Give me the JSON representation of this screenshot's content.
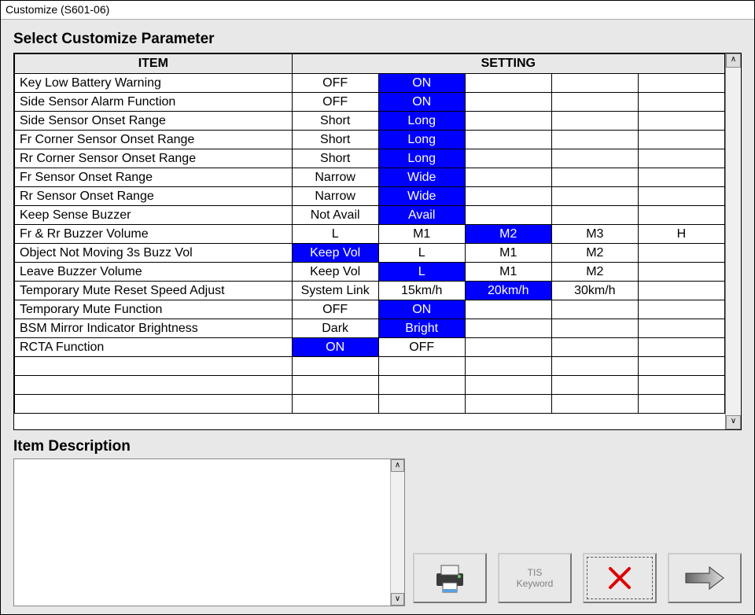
{
  "window": {
    "title": "Customize (S601-06)"
  },
  "headings": {
    "select_param": "Select Customize Parameter",
    "item_desc": "Item Description"
  },
  "table": {
    "headers": {
      "item": "ITEM",
      "setting": "SETTING"
    },
    "rows": [
      {
        "item": "Key Low Battery Warning",
        "opts": [
          "OFF",
          "ON",
          "",
          "",
          ""
        ],
        "sel": 1
      },
      {
        "item": "Side Sensor Alarm Function",
        "opts": [
          "OFF",
          "ON",
          "",
          "",
          ""
        ],
        "sel": 1
      },
      {
        "item": "Side Sensor Onset Range",
        "opts": [
          "Short",
          "Long",
          "",
          "",
          ""
        ],
        "sel": 1
      },
      {
        "item": "Fr Corner Sensor Onset Range",
        "opts": [
          "Short",
          "Long",
          "",
          "",
          ""
        ],
        "sel": 1
      },
      {
        "item": "Rr Corner Sensor Onset Range",
        "opts": [
          "Short",
          "Long",
          "",
          "",
          ""
        ],
        "sel": 1
      },
      {
        "item": "Fr Sensor Onset Range",
        "opts": [
          "Narrow",
          "Wide",
          "",
          "",
          ""
        ],
        "sel": 1
      },
      {
        "item": "Rr Sensor Onset Range",
        "opts": [
          "Narrow",
          "Wide",
          "",
          "",
          ""
        ],
        "sel": 1
      },
      {
        "item": "Keep Sense Buzzer",
        "opts": [
          "Not Avail",
          "Avail",
          "",
          "",
          ""
        ],
        "sel": 1
      },
      {
        "item": "Fr & Rr Buzzer Volume",
        "opts": [
          "L",
          "M1",
          "M2",
          "M3",
          "H"
        ],
        "sel": 2
      },
      {
        "item": "Object Not Moving 3s Buzz Vol",
        "opts": [
          "Keep Vol",
          "L",
          "M1",
          "M2",
          ""
        ],
        "sel": 0
      },
      {
        "item": "Leave Buzzer Volume",
        "opts": [
          "Keep Vol",
          "L",
          "M1",
          "M2",
          ""
        ],
        "sel": 1
      },
      {
        "item": "Temporary Mute Reset Speed Adjust",
        "opts": [
          "System Link",
          "15km/h",
          "20km/h",
          "30km/h",
          ""
        ],
        "sel": 2
      },
      {
        "item": "Temporary Mute Function",
        "opts": [
          "OFF",
          "ON",
          "",
          "",
          ""
        ],
        "sel": 1
      },
      {
        "item": "BSM Mirror Indicator Brightness",
        "opts": [
          "Dark",
          "Bright",
          "",
          "",
          ""
        ],
        "sel": 1
      },
      {
        "item": "RCTA Function",
        "opts": [
          "ON",
          "OFF",
          "",
          "",
          ""
        ],
        "sel": 0
      },
      {
        "item": "",
        "opts": [
          "",
          "",
          "",
          "",
          ""
        ],
        "sel": -1
      },
      {
        "item": "",
        "opts": [
          "",
          "",
          "",
          "",
          ""
        ],
        "sel": -1
      },
      {
        "item": "",
        "opts": [
          "",
          "",
          "",
          "",
          ""
        ],
        "sel": -1
      }
    ]
  },
  "description": {
    "text": ""
  },
  "buttons": {
    "tis_keyword": "TIS\nKeyword"
  },
  "icons": {
    "print": "printer-icon",
    "cancel": "x-icon",
    "next": "arrow-right-icon"
  },
  "colors": {
    "selected_bg": "#0000ff",
    "selected_fg": "#ffffff"
  }
}
